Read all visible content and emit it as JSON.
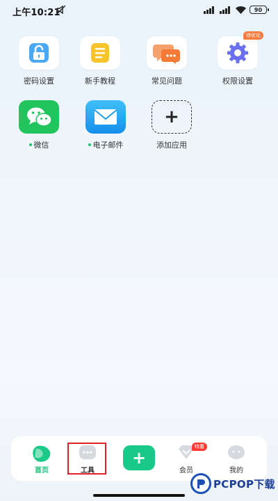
{
  "status_bar": {
    "time": "上午10:21",
    "battery": "90"
  },
  "apps": [
    {
      "label": "密码设置",
      "icon": "lock-icon"
    },
    {
      "label": "新手教程",
      "icon": "tutorial-icon"
    },
    {
      "label": "常见问题",
      "icon": "faq-chat-icon"
    },
    {
      "label": "权限设置",
      "icon": "gear-icon",
      "badge": "待优化"
    },
    {
      "label": "微信",
      "icon": "wechat-icon"
    },
    {
      "label": "电子邮件",
      "icon": "mail-icon"
    },
    {
      "label": "添加应用",
      "icon": "add-icon"
    }
  ],
  "bottom_nav": {
    "items": [
      {
        "label": "首页",
        "icon": "home-icon",
        "active": true
      },
      {
        "label": "工具",
        "icon": "tools-icon",
        "active": false
      },
      {
        "label": "",
        "icon": "plus-icon",
        "active": false
      },
      {
        "label": "会员",
        "icon": "vip-icon",
        "active": false,
        "badge": "特惠"
      },
      {
        "label": "我的",
        "icon": "profile-icon",
        "active": false
      }
    ]
  },
  "watermark": {
    "text": "PCPOP下载"
  },
  "colors": {
    "accent_green": "#19c98a",
    "highlight_red": "#e31e24",
    "badge_orange": "#f4793d"
  }
}
